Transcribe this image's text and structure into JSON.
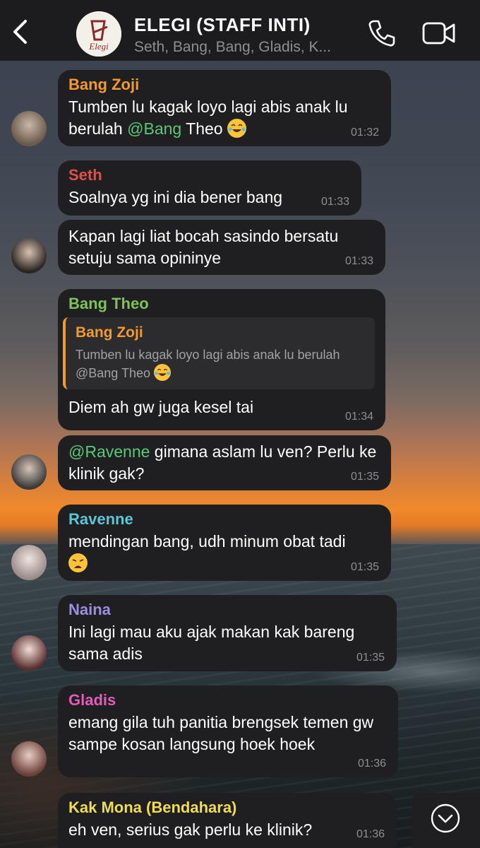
{
  "header": {
    "title": "ELEGI (STAFF INTI)",
    "subtitle": "Seth, Bang, Bang, Gladis, K...",
    "logo_text": "Elegi"
  },
  "messages": [
    {
      "sender": "Bang Zoji",
      "sender_color": "#f29a2e",
      "parts": [
        "Tumben lu kagak loyo lagi abis anak lu berulah ",
        "@Bang",
        " Theo "
      ],
      "time": "01:32"
    },
    {
      "sender": "Seth",
      "sender_color": "#e0504a",
      "text": "Soalnya yg ini dia bener bang",
      "time": "01:33"
    },
    {
      "text": "Kapan lagi liat bocah sasindo bersatu setuju sama opininye",
      "time": "01:33"
    },
    {
      "sender": "Bang Theo",
      "sender_color": "#7fc25a",
      "quote_name": "Bang Zoji",
      "quote_text": "Tumben lu kagak loyo lagi abis anak lu berulah @Bang Theo",
      "text": "Diem ah gw juga kesel tai",
      "time": "01:34"
    },
    {
      "parts": [
        "@Ravenne",
        " gimana aslam lu ven? Perlu ke klinik gak?"
      ],
      "time": "01:35"
    },
    {
      "sender": "Ravenne",
      "sender_color": "#5cc6d8",
      "text": "mendingan bang, udh minum obat tadi",
      "time": "01:35"
    },
    {
      "sender": "Naina",
      "sender_color": "#9b8fe0",
      "text": "Ini lagi mau aku ajak makan kak bareng sama adis",
      "time": "01:35"
    },
    {
      "sender": "Gladis",
      "sender_color": "#e05db8",
      "text": "emang gila tuh panitia brengsek temen gw sampe kosan langsung hoek hoek",
      "time": "01:36"
    },
    {
      "sender": "Kak Mona (Bendahara)",
      "sender_color": "#f0dc52",
      "text": "eh ven, serius gak perlu ke klinik?",
      "time": "01:36"
    }
  ],
  "icons": {
    "back": "chevron-left-icon",
    "call": "phone-icon",
    "video": "video-camera-icon",
    "scroll": "chevron-down-circle-icon"
  }
}
